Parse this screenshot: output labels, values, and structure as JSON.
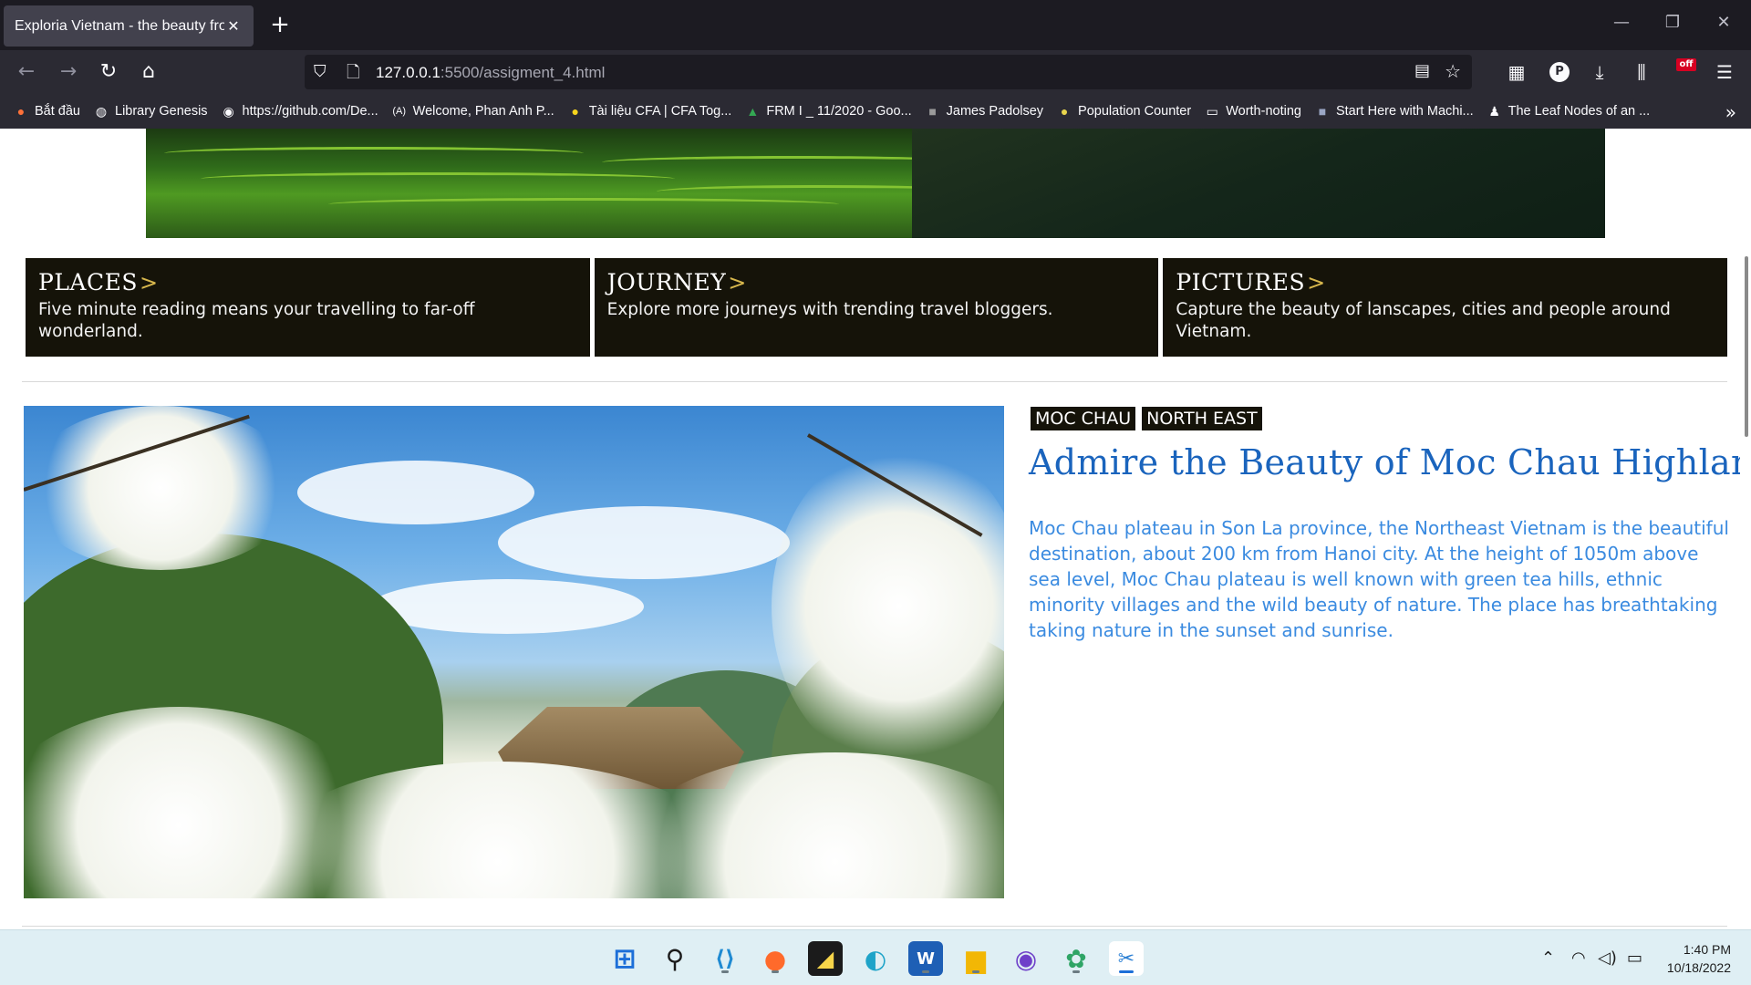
{
  "browser": {
    "tab_title": "Exploria Vietnam - the beauty from",
    "tab_close": "✕",
    "new_tab": "+",
    "url_host": "127.0.0.1",
    "url_rest": ":5500/assigment_4.html",
    "window_controls": [
      "—",
      "❐",
      "✕"
    ],
    "off_badge": "off",
    "p_badge": "P",
    "bookmarks": [
      {
        "label": "Bắt đầu",
        "icon": "firefox-icon"
      },
      {
        "label": "Library Genesis",
        "icon": "globe-icon"
      },
      {
        "label": "https://github.com/De...",
        "icon": "github-icon"
      },
      {
        "label": "Welcome, Phan Anh P...",
        "icon": "coursera-icon"
      },
      {
        "label": "Tài liệu CFA | CFA Tog...",
        "icon": "smiley-icon"
      },
      {
        "label": "FRM I _ 11/2020 - Goo...",
        "icon": "drive-icon"
      },
      {
        "label": "James Padolsey",
        "icon": "cube-icon"
      },
      {
        "label": "Population Counter",
        "icon": "pin-icon"
      },
      {
        "label": "Worth-noting",
        "icon": "folder-icon"
      },
      {
        "label": "Start Here with Machi...",
        "icon": "ml-icon"
      },
      {
        "label": "The Leaf Nodes of an ...",
        "icon": "person-icon"
      }
    ]
  },
  "cards": [
    {
      "title": "PLACES",
      "arrow": ">",
      "text": "Five minute reading means your travelling to far-off wonderland."
    },
    {
      "title": "JOURNEY",
      "arrow": ">",
      "text": "Explore more journeys with trending travel bloggers."
    },
    {
      "title": "PICTURES",
      "arrow": ">",
      "text": "Capture the beauty of lanscapes, cities and people around Vietnam."
    }
  ],
  "feature": {
    "tags": [
      "MOC CHAU",
      "NORTH EAST"
    ],
    "title": "Admire the Beauty of Moc Chau Highland",
    "text": "Moc Chau plateau in Son La province, the Northeast Vietnam is the beautiful destination, about 200 km from Hanoi city. At the height of 1050m above sea level, Moc Chau plateau is well known with green tea hills, ethnic minority villages and the wild beauty of nature. The place has breathtaking taking nature in the sunset and sunrise."
  },
  "taskbar": {
    "time": "1:40 PM",
    "date": "10/18/2022"
  },
  "colors": {
    "card_bg": "#151309",
    "title_blue": "#1a64bd",
    "text_blue": "#3b8be0",
    "arrow_gold": "#d7b74d"
  }
}
